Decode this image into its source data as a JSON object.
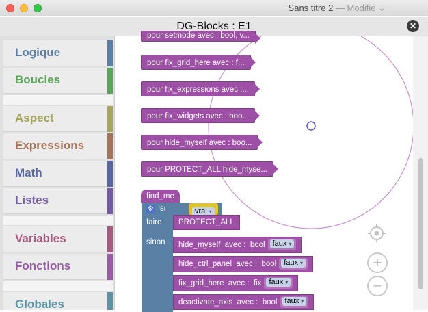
{
  "window": {
    "title": "Sans titre 2",
    "status": "— Modifié",
    "status_caret": "⌄"
  },
  "app": {
    "title": "DG-Blocks : E1",
    "close_glyph": "✕"
  },
  "toolbox": {
    "categories": [
      {
        "label": "Logique",
        "color": "#5b80a5"
      },
      {
        "label": "Boucles",
        "color": "#5ba55b"
      },
      {
        "label": "Aspect",
        "color": "#a5a55b"
      },
      {
        "label": "Expressions",
        "color": "#a5745b"
      },
      {
        "label": "Math",
        "color": "#5b67a5"
      },
      {
        "label": "Listes",
        "color": "#745ba5"
      },
      {
        "label": "Variables",
        "color": "#a55b80"
      },
      {
        "label": "Fonctions",
        "color": "#995ba5"
      },
      {
        "label": "Globales",
        "color": "#5b93a5"
      }
    ]
  },
  "workspace": {
    "procedure_calls": [
      "pour setmode avec : bool, v...",
      "pour fix_grid_here avec : f...",
      "pour fix_expressions avec :...",
      "pour fix_widgets avec : boo...",
      "pour hide_myself avec : boo...",
      "pour PROTECT_ALL  hide_myse..."
    ],
    "find_me": "find_me",
    "if_block": {
      "si": "si",
      "faire": "faire",
      "sinon": "sinon",
      "condition": "vrai",
      "do": "PROTECT_ALL"
    },
    "else_statements": [
      {
        "name": "hide_myself",
        "avec": "avec :",
        "param": "bool",
        "value": "faux"
      },
      {
        "name": "hide_ctrl_panel",
        "avec": "avec :",
        "param": "bool",
        "value": "faux"
      },
      {
        "name": "fix_grid_here",
        "avec": "avec :",
        "param": "fix",
        "value": "faux"
      },
      {
        "name": "deactivate_axis",
        "avec": "avec :",
        "param": "bool",
        "value": "faux"
      }
    ],
    "dropdown_caret": "▾",
    "controls": {
      "recenter_icon": "crosshair-icon",
      "zoom_in": "+",
      "zoom_out": "−"
    },
    "colors": {
      "procedure": "#9e50a6",
      "logic": "#5b80a5",
      "selection": "#f5c000",
      "circle": "#c98fd0"
    }
  }
}
